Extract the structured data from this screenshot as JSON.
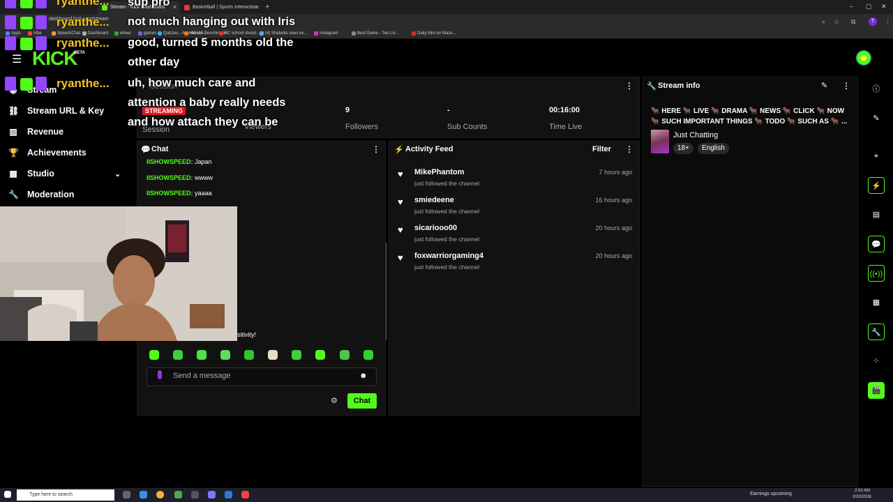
{
  "browser": {
    "tabs": [
      {
        "label": "Stream - Kick Dashboard",
        "active": true
      },
      {
        "label": "Basketball | Sports Interaction",
        "active": false
      }
    ],
    "address": "dashboard.kick.com/stream",
    "bookmarks": [
      {
        "label": "Apps",
        "color": "#4a8af4"
      },
      {
        "label": "tribe",
        "color": "#e44"
      },
      {
        "label": "SpeechChat",
        "color": "#e94"
      },
      {
        "label": "Dashboard",
        "color": "#aaa"
      },
      {
        "label": "wheel",
        "color": "#3a3"
      },
      {
        "label": "games",
        "color": "#66d"
      },
      {
        "label": "Quizzes - A world of f...",
        "color": "#3ad"
      },
      {
        "label": "Human Benchmark",
        "color": "#f70"
      },
      {
        "label": "BC school shooti...",
        "color": "#d33"
      },
      {
        "label": "(4) Students seen ex...",
        "color": "#5af"
      },
      {
        "label": "Instagram",
        "color": "#d3a"
      },
      {
        "label": "Best Game - Tier Lis...",
        "color": "#888"
      },
      {
        "label": "Daily Mini on Maze...",
        "color": "#c33"
      }
    ]
  },
  "header": {
    "logo": "KICK",
    "beta": "BETA"
  },
  "sidebar": {
    "items": [
      {
        "label": "Stream",
        "icon": "broadcast-icon"
      },
      {
        "label": "Stream URL & Key",
        "icon": "link-icon"
      },
      {
        "label": "Revenue",
        "icon": "chart-icon"
      },
      {
        "label": "Achievements",
        "icon": "trophy-icon"
      },
      {
        "label": "Studio",
        "icon": "studio-icon"
      },
      {
        "label": "Moderation",
        "icon": "wrench-icon"
      }
    ]
  },
  "stats": {
    "status": "STREAMING",
    "session_label": "Session",
    "viewers_label": "Viewers",
    "followers_value": "9",
    "followers_label": "Followers",
    "subs_value": "-",
    "subs_label": "Sub Counts",
    "time_value": "00:16:00",
    "time_label": "Time Live"
  },
  "chat": {
    "title": "Chat",
    "messages": [
      {
        "user": "IISHOWSPEED:",
        "text": "Japan"
      },
      {
        "user": "IISHOWSPEED:",
        "text": "wwww"
      },
      {
        "user": "IISHOWSPEED:",
        "text": "yaaaa"
      }
    ],
    "partial_text": "sitivity!",
    "placeholder": "Send a message",
    "send_label": "Chat"
  },
  "activity": {
    "title": "Activity Feed",
    "filter_label": "Filter",
    "items": [
      {
        "name": "MikePhantom",
        "action": "just followed the channel",
        "time": "7 hours ago"
      },
      {
        "name": "smiedeene",
        "action": "just followed the channel",
        "time": "16 hours ago"
      },
      {
        "name": "sicariooo00",
        "action": "just followed the channel",
        "time": "20 hours ago"
      },
      {
        "name": "foxwarriorgaming4",
        "action": "just followed the channel",
        "time": "20 hours ago"
      }
    ]
  },
  "stream_info": {
    "title": "Stream info",
    "stream_title": "🐂 HERE 🐂 LIVE 🐂 DRAMA 🐂 NEWS 🐂 CLICK 🐂 NOW 🐂 SUCH IMPORTANT THINGS 🐂 TODO 🐂 SUCH AS 🐂 ...",
    "category": "Just Chatting",
    "tags": [
      "18+",
      "English"
    ]
  },
  "overlay": {
    "username": "ryanthe...",
    "captions": [
      "sup pro",
      "not much hanging out with Iris",
      "good, turned 5 months old the",
      "other day",
      "uh, how much care and",
      "attention a baby really needs",
      "and how attach they can be"
    ]
  },
  "taskbar": {
    "search_placeholder": "Type here to search",
    "weather": "Earnings upcoming",
    "time": "2:02 AM",
    "date": "2/20/2026"
  },
  "colors": {
    "accent": "#53fc18",
    "live": "#e0161e",
    "bg": "#000000",
    "card": "#121212"
  }
}
